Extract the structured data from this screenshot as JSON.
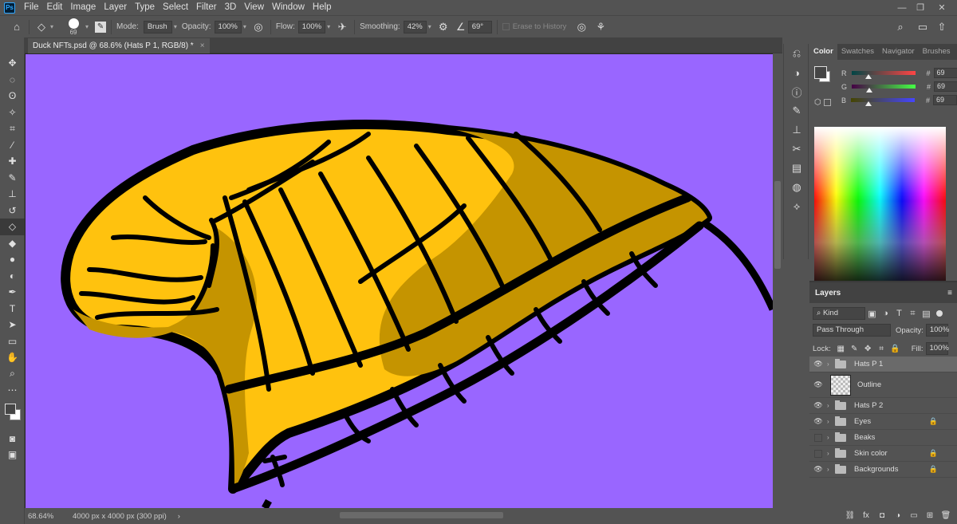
{
  "app": {
    "logo": "Ps"
  },
  "menu": [
    "File",
    "Edit",
    "Image",
    "Layer",
    "Type",
    "Select",
    "Filter",
    "3D",
    "View",
    "Window",
    "Help"
  ],
  "window_controls": {
    "minimize": "—",
    "restore": "❐",
    "close": "✕"
  },
  "options": {
    "brush_size": "69",
    "mode_label": "Mode:",
    "mode_value": "Brush",
    "opacity_label": "Opacity:",
    "opacity_value": "100%",
    "flow_label": "Flow:",
    "flow_value": "100%",
    "smoothing_label": "Smoothing:",
    "smoothing_value": "42%",
    "angle_value": "69°",
    "erase_history_label": "Erase to History"
  },
  "document": {
    "tab_title": "Duck NFTs.psd @ 68.6% (Hats P 1, RGB/8) *",
    "close": "×"
  },
  "status": {
    "zoom": "68.64%",
    "dimensions": "4000 px x 4000 px (300 ppi)",
    "arrow": "›"
  },
  "color_panel": {
    "tabs": [
      "Color",
      "Swatches",
      "Navigator",
      "Brushes"
    ],
    "channels": [
      {
        "label": "R",
        "value": "69",
        "pos": 0.27
      },
      {
        "label": "G",
        "value": "69",
        "pos": 0.27
      },
      {
        "label": "B",
        "value": "69",
        "pos": 0.27
      }
    ],
    "hash": "#"
  },
  "layers_panel": {
    "title": "Layers",
    "filter_kind": "Kind",
    "blend_mode": "Pass Through",
    "opacity_label": "Opacity:",
    "opacity_value": "100%",
    "lock_label": "Lock:",
    "fill_label": "Fill:",
    "fill_value": "100%",
    "layers": [
      {
        "name": "Hats P 1",
        "visible": true,
        "type": "group",
        "selected": true,
        "locked": false
      },
      {
        "name": "Outline",
        "visible": true,
        "type": "layer",
        "selected": false,
        "locked": false
      },
      {
        "name": "Hats P 2",
        "visible": true,
        "type": "group",
        "selected": false,
        "locked": false
      },
      {
        "name": "Eyes",
        "visible": true,
        "type": "group",
        "selected": false,
        "locked": true
      },
      {
        "name": "Beaks",
        "visible": false,
        "type": "group",
        "selected": false,
        "locked": false
      },
      {
        "name": "Skin color",
        "visible": false,
        "type": "group",
        "selected": false,
        "locked": true
      },
      {
        "name": "Backgrounds",
        "visible": true,
        "type": "group",
        "selected": false,
        "locked": true
      }
    ]
  },
  "colors": {
    "canvas_bg": "#9966ff",
    "hat_yellow": "#ffc20e",
    "hat_shadow": "#c59400",
    "outline": "#000000"
  }
}
